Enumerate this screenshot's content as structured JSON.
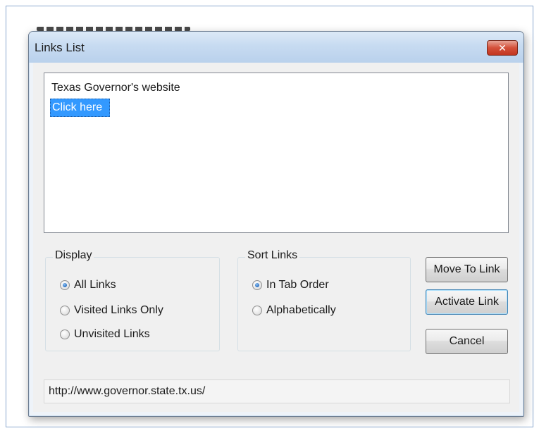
{
  "window": {
    "title": "Links List",
    "close_glyph": "✕"
  },
  "links_list": {
    "items": [
      {
        "label": "Texas Governor's website",
        "selected": false
      },
      {
        "label": "Click here",
        "selected": true
      }
    ]
  },
  "display_group": {
    "title": "Display",
    "options": [
      {
        "label": "All Links",
        "checked": true
      },
      {
        "label": "Visited Links Only",
        "checked": false
      },
      {
        "label": "Unvisited Links",
        "checked": false
      }
    ]
  },
  "sort_group": {
    "title": "Sort Links",
    "options": [
      {
        "label": "In Tab Order",
        "checked": true
      },
      {
        "label": "Alphabetically",
        "checked": false
      }
    ]
  },
  "buttons": {
    "move_to_link": "Move To Link",
    "activate_link": "Activate Link",
    "cancel": "Cancel"
  },
  "status": {
    "url": "http://www.governor.state.tx.us/"
  },
  "colors": {
    "selection": "#3399ff",
    "titlebar": "#c7dbf1",
    "close_button": "#d4503a"
  },
  "icons": {
    "close": "close-icon",
    "radio": "radio-icon"
  }
}
